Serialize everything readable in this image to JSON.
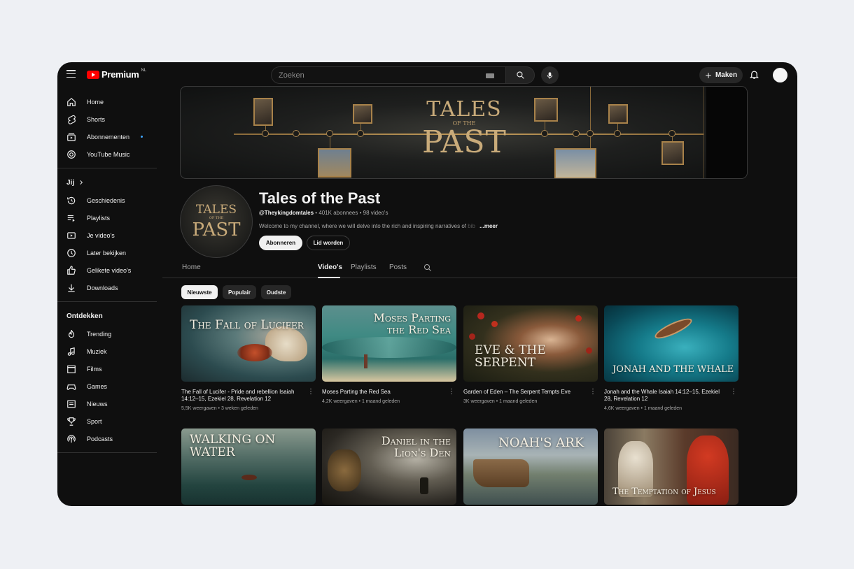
{
  "header": {
    "logo_text": "Premium",
    "logo_region": "NL",
    "search_placeholder": "Zoeken",
    "create_label": "Maken"
  },
  "sidebar": {
    "main": [
      {
        "label": "Home",
        "icon": "home-icon"
      },
      {
        "label": "Shorts",
        "icon": "shorts-icon"
      },
      {
        "label": "Abonnementen",
        "icon": "subscriptions-icon"
      },
      {
        "label": "YouTube Music",
        "icon": "music-disc-icon"
      }
    ],
    "you_heading": "Jij",
    "you": [
      {
        "label": "Geschiedenis",
        "icon": "history-icon"
      },
      {
        "label": "Playlists",
        "icon": "playlists-icon"
      },
      {
        "label": "Je video's",
        "icon": "your-videos-icon"
      },
      {
        "label": "Later bekijken",
        "icon": "clock-icon"
      },
      {
        "label": "Gelikete video's",
        "icon": "thumbs-up-icon"
      },
      {
        "label": "Downloads",
        "icon": "download-icon"
      }
    ],
    "explore_heading": "Ontdekken",
    "explore": [
      {
        "label": "Trending",
        "icon": "flame-icon"
      },
      {
        "label": "Muziek",
        "icon": "music-note-icon"
      },
      {
        "label": "Films",
        "icon": "clapper-icon"
      },
      {
        "label": "Games",
        "icon": "gamepad-icon"
      },
      {
        "label": "Nieuws",
        "icon": "news-icon"
      },
      {
        "label": "Sport",
        "icon": "trophy-icon"
      },
      {
        "label": "Podcasts",
        "icon": "podcast-icon"
      }
    ]
  },
  "banner": {
    "title_line1": "TALES",
    "title_line2": "OF THE",
    "title_line3": "PAST"
  },
  "channel": {
    "avatar_line1": "TALES",
    "avatar_line2": "OF THE",
    "avatar_line3": "PAST",
    "name": "Tales of the Past",
    "handle": "@Theykingdomtales",
    "subscribers": "401K abonnees",
    "videos": "98 video's",
    "description": "Welcome to my channel, where we will delve into the rich and inspiring narratives of",
    "description_fade": "bib",
    "more": "...meer",
    "subscribe_label": "Abonneren",
    "join_label": "Lid worden"
  },
  "tabs": [
    "Home",
    "Video's",
    "Playlists",
    "Posts"
  ],
  "active_tab": "Video's",
  "chips": [
    "Nieuwste",
    "Populair",
    "Oudste"
  ],
  "videos": [
    {
      "thumb_text": "The Fall of Lucifer",
      "title": "The Fall of Lucifer - Pride and rebellion Isaiah 14:12–15, Ezekiel 28, Revelation 12",
      "views": "5,5K weergaven",
      "age": "3 weken geleden"
    },
    {
      "thumb_text": "Moses Parting the Red Sea",
      "title": "Moses Parting the Red Sea",
      "views": "4,2K weergaven",
      "age": "1 maand geleden"
    },
    {
      "thumb_text": "EVE & THE SERPENT",
      "title": "Garden of Eden – The Serpent Tempts Eve",
      "views": "3K weergaven",
      "age": "1 maand geleden"
    },
    {
      "thumb_text": "JONAH AND THE WHALE",
      "title": "Jonah and the Whale Isaiah 14:12–15, Ezekiel 28, Revelation 12",
      "views": "4,6K weergaven",
      "age": "1 maand geleden"
    },
    {
      "thumb_text": "WALKING ON WATER"
    },
    {
      "thumb_text": "Daniel in the Lion's Den"
    },
    {
      "thumb_text": "NOAH'S ARK"
    },
    {
      "thumb_text": "The Temptation of Jesus"
    }
  ],
  "meta_separator": "•"
}
